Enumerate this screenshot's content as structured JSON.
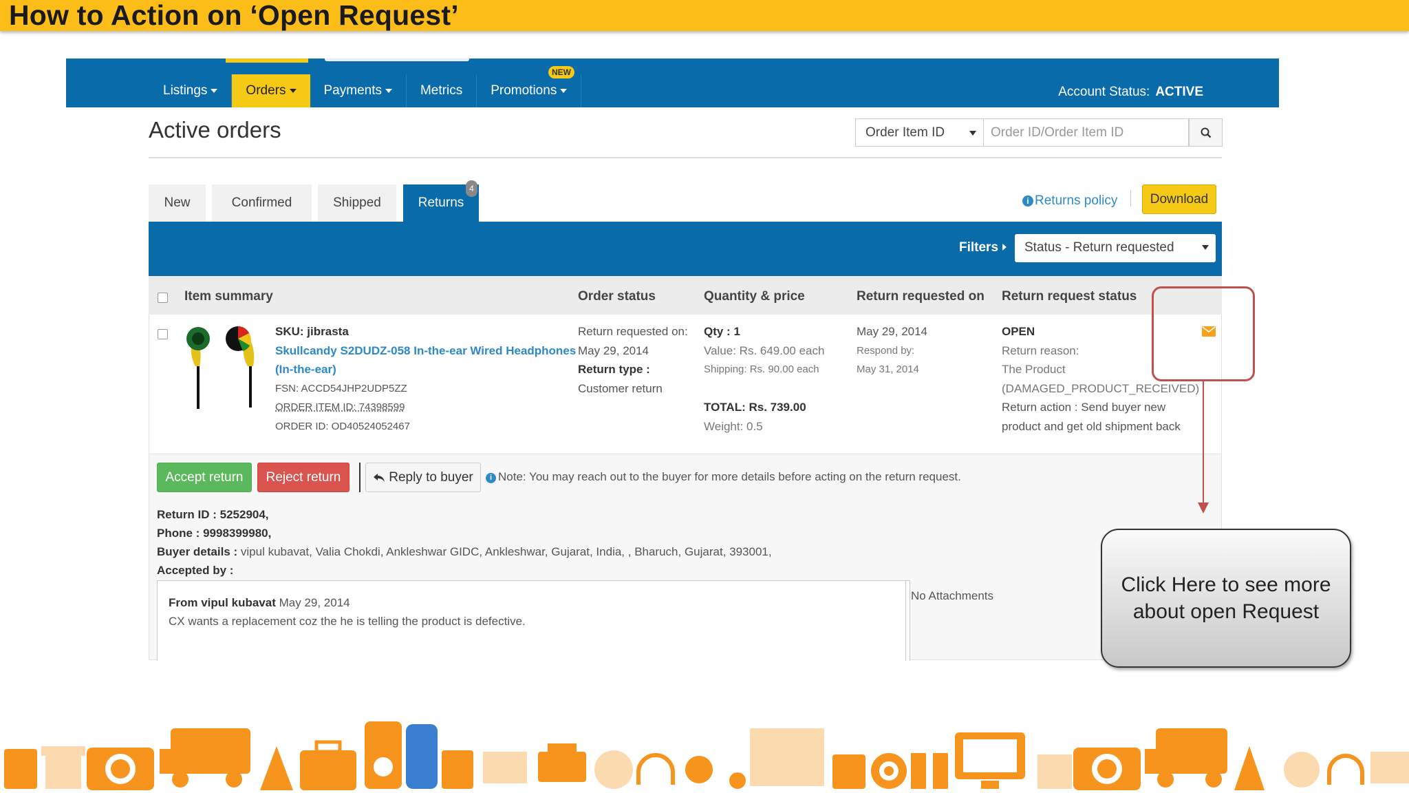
{
  "slide": {
    "title": "How to Action on ‘Open Request’"
  },
  "header": {
    "nav": [
      {
        "label": "Listings",
        "caret": true
      },
      {
        "label": "Orders",
        "caret": true,
        "active": true
      },
      {
        "label": "Payments",
        "caret": true
      },
      {
        "label": "Metrics",
        "caret": false
      },
      {
        "label": "Promotions",
        "caret": true
      }
    ],
    "new_badge": "NEW",
    "account_label": "Account Status:",
    "account_value": "ACTIVE"
  },
  "page": {
    "title": "Active orders"
  },
  "search": {
    "select_value": "Order Item ID",
    "placeholder": "Order ID/Order Item ID"
  },
  "tabs": [
    {
      "label": "New"
    },
    {
      "label": "Confirmed"
    },
    {
      "label": "Shipped"
    },
    {
      "label": "Returns",
      "active": true
    }
  ],
  "tab_count": "4",
  "returns_policy": "Returns policy",
  "download_label": "Download",
  "filters": {
    "label": "Filters",
    "status_value": "Status - Return requested"
  },
  "table": {
    "headers": [
      "Item summary",
      "Order status",
      "Quantity & price",
      "Return requested on",
      "Return request status"
    ]
  },
  "row": {
    "sku_label": "SKU:",
    "sku": "jibrasta",
    "product_line1": "Skullcandy S2DUDZ-058 In-the-ear Wired Headphones",
    "product_line2": "(In-the-ear)",
    "fsn": "FSN: ACCD54JHP2UDP5ZZ",
    "order_item_id": "ORDER ITEM ID: 74398599",
    "order_id": "ORDER ID: OD40524052467",
    "order_status": {
      "requested_label": "Return requested on:",
      "requested_date": "May 29, 2014",
      "type_label": "Return type :",
      "type_value": "Customer return"
    },
    "quantity": {
      "qty": "Qty : 1",
      "value": "Value: Rs. 649.00 each",
      "shipping": "Shipping: Rs. 90.00 each",
      "total": "TOTAL: Rs. 739.00",
      "weight": "Weight: 0.5"
    },
    "requested_on": {
      "date": "May 29, 2014",
      "respond_label": "Respond by:",
      "respond_date": "May 31, 2014"
    },
    "request_status": {
      "status": "OPEN",
      "reason_label": "Return reason:",
      "reason_line1": "The Product",
      "reason_line2": "(DAMAGED_PRODUCT_RECEIVED)",
      "action_line1": "Return action : Send buyer new",
      "action_line2": "product and get old shipment back"
    }
  },
  "actions": {
    "accept": "Accept return",
    "reject": "Reject return",
    "reply": "Reply to buyer",
    "note": "Note: You may reach out to the buyer for more details before acting on the return request."
  },
  "details": {
    "return_id_label": "Return ID :",
    "return_id": "5252904,",
    "phone_label": "Phone :",
    "phone": "9998399980,",
    "buyer_label": "Buyer details :",
    "buyer": "vipul kubavat, Valia Chokdi, Ankleshwar GIDC, Ankleshwar, Gujarat, India, , Bharuch, Gujarat, 393001,",
    "accepted_label": "Accepted by :"
  },
  "message": {
    "from": "From vipul kubavat",
    "date": "May 29, 2014",
    "body": "CX wants a replacement coz the he is telling the product is defective.",
    "attachments": "No Attachments"
  },
  "callout": {
    "text": "Click Here to see more about open Request"
  },
  "colors": {
    "brand_blue": "#0a6bab",
    "accent_yellow": "#f6c915",
    "slide_yellow": "#fdbd18",
    "accept_green": "#5cb85c",
    "reject_red": "#d9534f",
    "annotation_red": "#c0504d",
    "decor_orange": "#f7941d"
  },
  "decor_icons": [
    "calculator-icon",
    "gift-icon",
    "camera-icon",
    "truck-icon",
    "cone-icon",
    "suitcase-icon",
    "ipod-icon",
    "phone-icon",
    "calculator-icon",
    "monitor-icon",
    "printer-icon",
    "clock-icon",
    "headphones-icon",
    "gear-icon",
    "book-icon",
    "calendar-icon",
    "target-icon",
    "binoculars-icon",
    "monitor-icon",
    "gift-icon",
    "camera-icon",
    "truck-icon",
    "cone-icon",
    "clock-icon",
    "headphones-icon"
  ]
}
